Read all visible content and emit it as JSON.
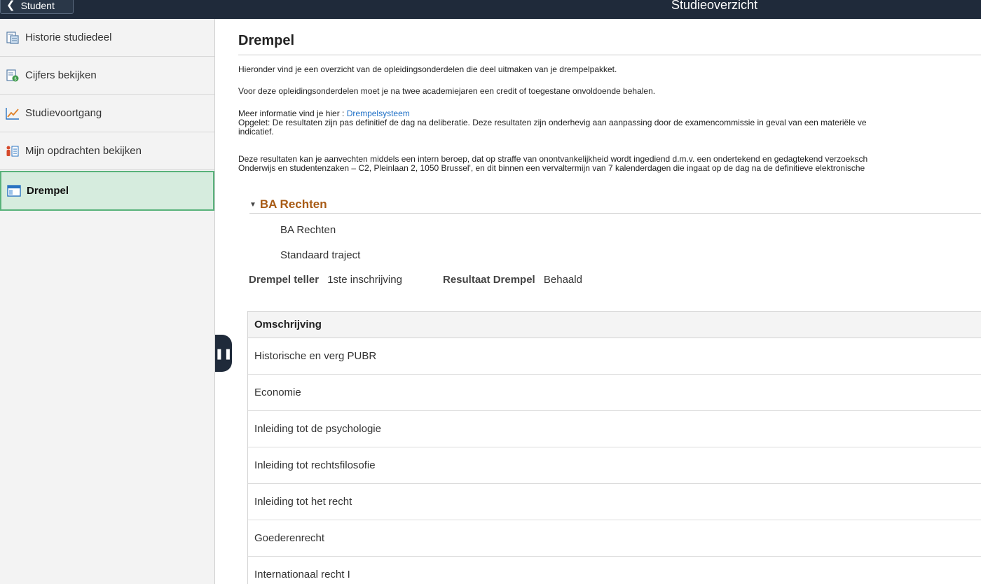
{
  "header": {
    "back_label": "Student",
    "title": "Studieoverzicht"
  },
  "sidebar": {
    "items": [
      {
        "label": "Historie studiedeel",
        "icon": "report-icon"
      },
      {
        "label": "Cijfers bekijken",
        "icon": "grades-icon"
      },
      {
        "label": "Studievoortgang",
        "icon": "line-chart-icon"
      },
      {
        "label": "Mijn opdrachten bekijken",
        "icon": "tasks-icon"
      },
      {
        "label": "Drempel",
        "icon": "window-icon",
        "active": true
      }
    ]
  },
  "main": {
    "title": "Drempel",
    "intro1": "Hieronder vind je een overzicht van de opleidingsonderdelen die deel uitmaken van je drempelpakket.",
    "intro2": "Voor deze opleidingsonderdelen moet je na twee academiejaren een credit of toegestane onvoldoende behalen.",
    "info_prefix": "Meer informatie vind je hier : ",
    "info_link": "Drempelsysteem",
    "notice_line1": "Opgelet: De resultaten zijn pas definitief de dag na deliberatie. Deze resultaten zijn onderhevig aan aanpassing door de examencommissie in geval van een materiële ve",
    "notice_line2": "indicatief.",
    "appeal_line1": "Deze resultaten kan je aanvechten middels een intern beroep, dat op straffe van onontvankelijkheid wordt ingediend d.m.v. een ondertekend en gedagtekend verzoeksch",
    "appeal_line2": "Onderwijs en studentenzaken – C2, Pleinlaan 2, 1050 Brussel', en dit binnen een vervaltermijn van 7 kalenderdagen die ingaat op de dag na de definitieve elektronische",
    "section_title": "BA Rechten",
    "program": "BA Rechten",
    "track": "Standaard traject",
    "counter_label": "Drempel teller",
    "counter_value": "1ste inschrijving",
    "result_label": "Resultaat Drempel",
    "result_value": "Behaald",
    "table": {
      "header": "Omschrijving",
      "rows": [
        "Historische en verg PUBR",
        "Economie",
        "Inleiding tot de psychologie",
        "Inleiding tot rechtsfilosofie",
        "Inleiding tot het recht",
        "Goederenrecht",
        "Internationaal recht I"
      ]
    }
  },
  "colors": {
    "topbar": "#1f2a3a",
    "active_bg": "#d6ecde",
    "active_border": "#58b27a",
    "section_title": "#a85b15",
    "link": "#1d6fc6"
  }
}
